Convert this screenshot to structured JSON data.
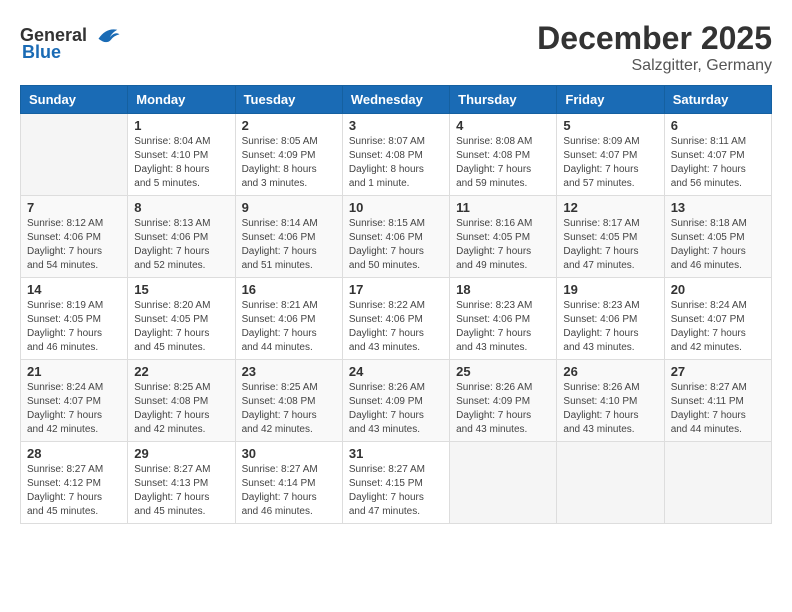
{
  "header": {
    "logo_general": "General",
    "logo_blue": "Blue",
    "month": "December 2025",
    "location": "Salzgitter, Germany"
  },
  "days_of_week": [
    "Sunday",
    "Monday",
    "Tuesday",
    "Wednesday",
    "Thursday",
    "Friday",
    "Saturday"
  ],
  "weeks": [
    [
      {
        "day": "",
        "info": ""
      },
      {
        "day": "1",
        "info": "Sunrise: 8:04 AM\nSunset: 4:10 PM\nDaylight: 8 hours\nand 5 minutes."
      },
      {
        "day": "2",
        "info": "Sunrise: 8:05 AM\nSunset: 4:09 PM\nDaylight: 8 hours\nand 3 minutes."
      },
      {
        "day": "3",
        "info": "Sunrise: 8:07 AM\nSunset: 4:08 PM\nDaylight: 8 hours\nand 1 minute."
      },
      {
        "day": "4",
        "info": "Sunrise: 8:08 AM\nSunset: 4:08 PM\nDaylight: 7 hours\nand 59 minutes."
      },
      {
        "day": "5",
        "info": "Sunrise: 8:09 AM\nSunset: 4:07 PM\nDaylight: 7 hours\nand 57 minutes."
      },
      {
        "day": "6",
        "info": "Sunrise: 8:11 AM\nSunset: 4:07 PM\nDaylight: 7 hours\nand 56 minutes."
      }
    ],
    [
      {
        "day": "7",
        "info": "Sunrise: 8:12 AM\nSunset: 4:06 PM\nDaylight: 7 hours\nand 54 minutes."
      },
      {
        "day": "8",
        "info": "Sunrise: 8:13 AM\nSunset: 4:06 PM\nDaylight: 7 hours\nand 52 minutes."
      },
      {
        "day": "9",
        "info": "Sunrise: 8:14 AM\nSunset: 4:06 PM\nDaylight: 7 hours\nand 51 minutes."
      },
      {
        "day": "10",
        "info": "Sunrise: 8:15 AM\nSunset: 4:06 PM\nDaylight: 7 hours\nand 50 minutes."
      },
      {
        "day": "11",
        "info": "Sunrise: 8:16 AM\nSunset: 4:05 PM\nDaylight: 7 hours\nand 49 minutes."
      },
      {
        "day": "12",
        "info": "Sunrise: 8:17 AM\nSunset: 4:05 PM\nDaylight: 7 hours\nand 47 minutes."
      },
      {
        "day": "13",
        "info": "Sunrise: 8:18 AM\nSunset: 4:05 PM\nDaylight: 7 hours\nand 46 minutes."
      }
    ],
    [
      {
        "day": "14",
        "info": "Sunrise: 8:19 AM\nSunset: 4:05 PM\nDaylight: 7 hours\nand 46 minutes."
      },
      {
        "day": "15",
        "info": "Sunrise: 8:20 AM\nSunset: 4:05 PM\nDaylight: 7 hours\nand 45 minutes."
      },
      {
        "day": "16",
        "info": "Sunrise: 8:21 AM\nSunset: 4:06 PM\nDaylight: 7 hours\nand 44 minutes."
      },
      {
        "day": "17",
        "info": "Sunrise: 8:22 AM\nSunset: 4:06 PM\nDaylight: 7 hours\nand 43 minutes."
      },
      {
        "day": "18",
        "info": "Sunrise: 8:23 AM\nSunset: 4:06 PM\nDaylight: 7 hours\nand 43 minutes."
      },
      {
        "day": "19",
        "info": "Sunrise: 8:23 AM\nSunset: 4:06 PM\nDaylight: 7 hours\nand 43 minutes."
      },
      {
        "day": "20",
        "info": "Sunrise: 8:24 AM\nSunset: 4:07 PM\nDaylight: 7 hours\nand 42 minutes."
      }
    ],
    [
      {
        "day": "21",
        "info": "Sunrise: 8:24 AM\nSunset: 4:07 PM\nDaylight: 7 hours\nand 42 minutes."
      },
      {
        "day": "22",
        "info": "Sunrise: 8:25 AM\nSunset: 4:08 PM\nDaylight: 7 hours\nand 42 minutes."
      },
      {
        "day": "23",
        "info": "Sunrise: 8:25 AM\nSunset: 4:08 PM\nDaylight: 7 hours\nand 42 minutes."
      },
      {
        "day": "24",
        "info": "Sunrise: 8:26 AM\nSunset: 4:09 PM\nDaylight: 7 hours\nand 43 minutes."
      },
      {
        "day": "25",
        "info": "Sunrise: 8:26 AM\nSunset: 4:09 PM\nDaylight: 7 hours\nand 43 minutes."
      },
      {
        "day": "26",
        "info": "Sunrise: 8:26 AM\nSunset: 4:10 PM\nDaylight: 7 hours\nand 43 minutes."
      },
      {
        "day": "27",
        "info": "Sunrise: 8:27 AM\nSunset: 4:11 PM\nDaylight: 7 hours\nand 44 minutes."
      }
    ],
    [
      {
        "day": "28",
        "info": "Sunrise: 8:27 AM\nSunset: 4:12 PM\nDaylight: 7 hours\nand 45 minutes."
      },
      {
        "day": "29",
        "info": "Sunrise: 8:27 AM\nSunset: 4:13 PM\nDaylight: 7 hours\nand 45 minutes."
      },
      {
        "day": "30",
        "info": "Sunrise: 8:27 AM\nSunset: 4:14 PM\nDaylight: 7 hours\nand 46 minutes."
      },
      {
        "day": "31",
        "info": "Sunrise: 8:27 AM\nSunset: 4:15 PM\nDaylight: 7 hours\nand 47 minutes."
      },
      {
        "day": "",
        "info": ""
      },
      {
        "day": "",
        "info": ""
      },
      {
        "day": "",
        "info": ""
      }
    ]
  ]
}
